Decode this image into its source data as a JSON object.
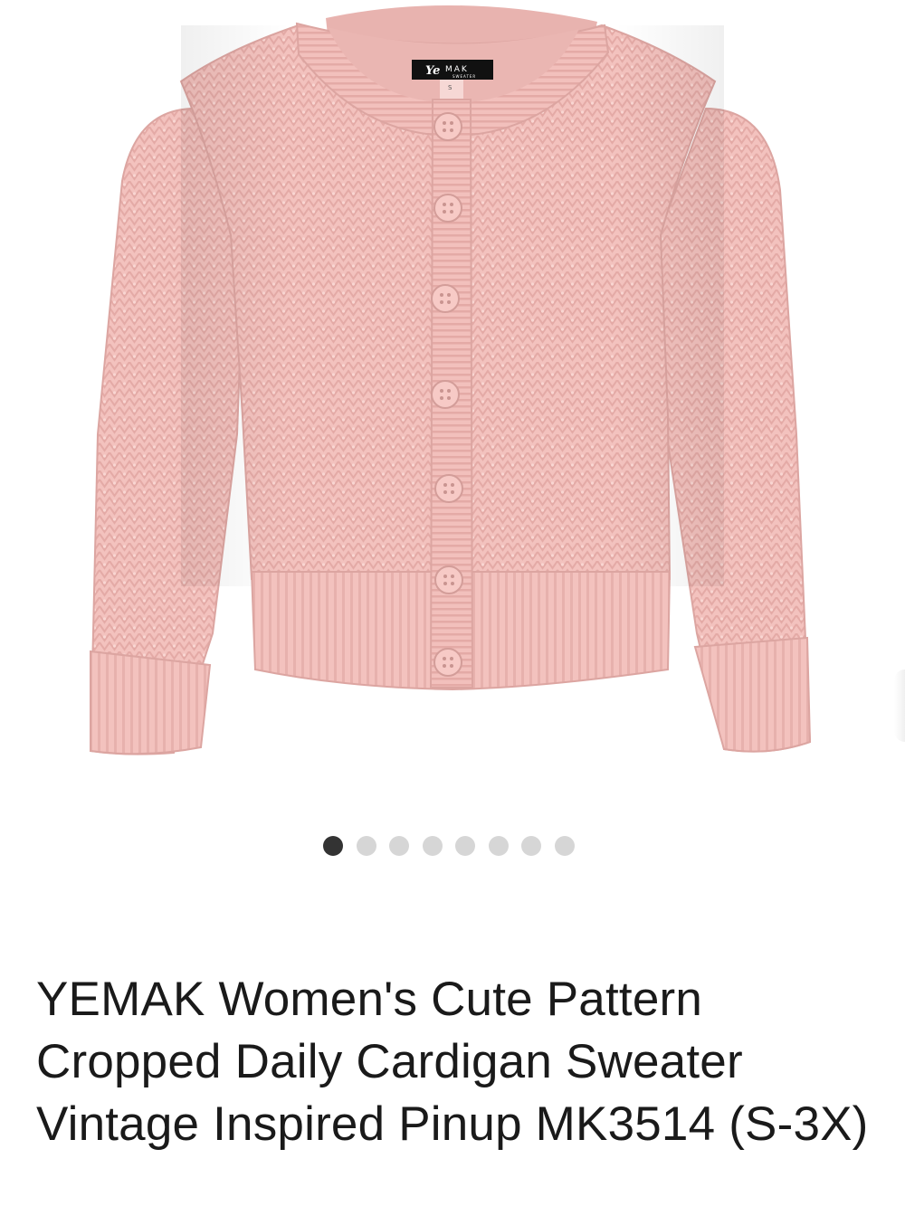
{
  "product": {
    "title": "YEMAK Women's Cute Pattern Cropped Daily Cardigan Sweater Vintage Inspired Pinup MK3514 (S-3X)",
    "image_alt": "Pink cropped knit cardigan sweater with buttons",
    "brand_label_logo": "Ye",
    "brand_label_text": "MAK",
    "brand_label_sub": "SWEATER",
    "size_tag": "S",
    "sweater_color": "#f4c3bf"
  },
  "gallery": {
    "total_images": 8,
    "active_index": 0,
    "active_dot_color": "#333333",
    "inactive_dot_color": "#d6d6d6"
  }
}
